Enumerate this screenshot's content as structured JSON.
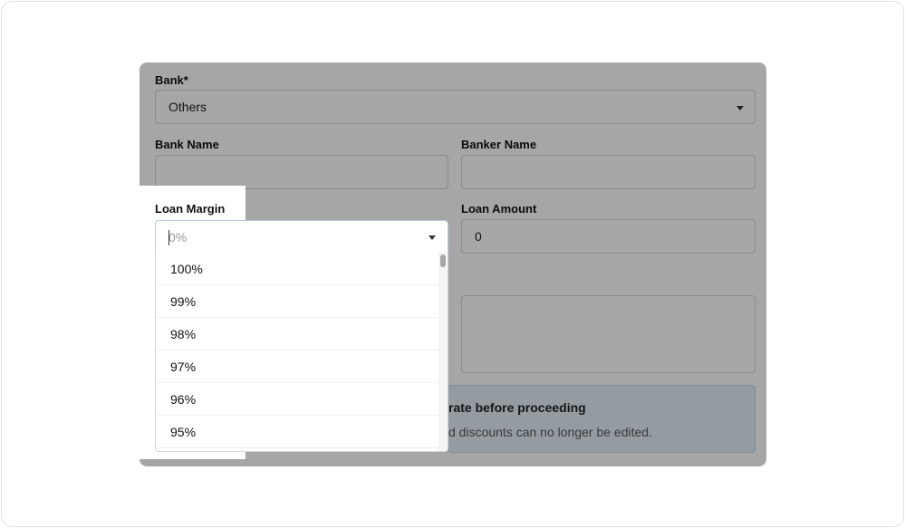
{
  "form": {
    "bank_label": "Bank*",
    "bank_value": "Others",
    "bank_name_label": "Bank Name",
    "bank_name_value": "",
    "banker_name_label": "Banker Name",
    "banker_name_value": "",
    "loan_margin_label": "Loan Margin",
    "loan_margin_placeholder": "0%",
    "loan_amount_label": "Loan Amount",
    "loan_amount_value": "0"
  },
  "alert": {
    "title": "rate before proceeding",
    "text": "d discounts can no longer be edited."
  },
  "loan_margin_options": [
    "100%",
    "99%",
    "98%",
    "97%",
    "96%",
    "95%"
  ],
  "colors": {
    "overlay": "rgba(0,0,0,0.35)",
    "alert_bg": "#e3eef8"
  }
}
